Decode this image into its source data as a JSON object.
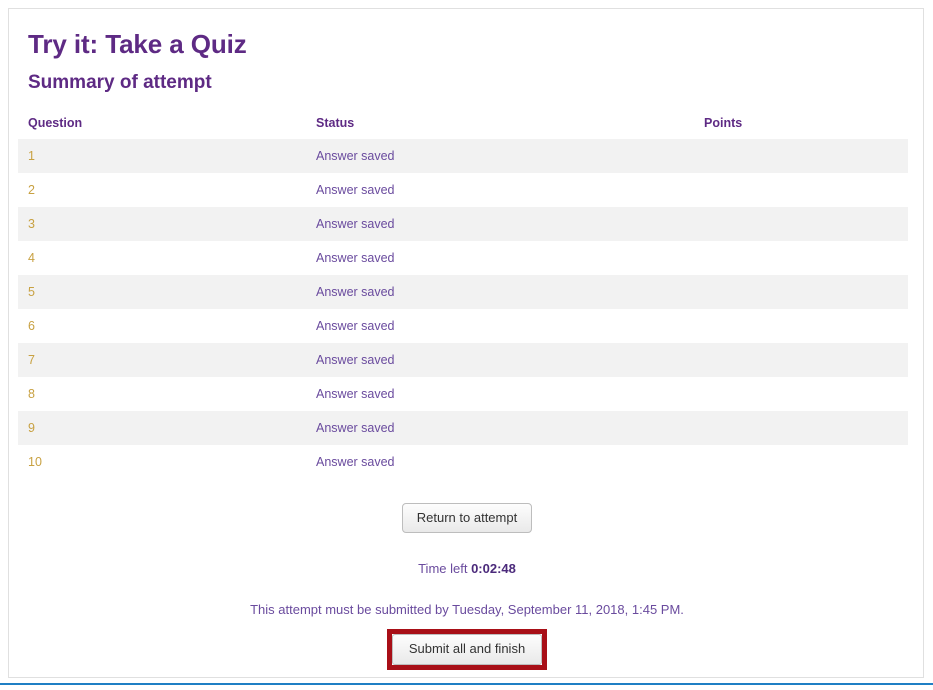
{
  "page": {
    "title": "Try it: Take a Quiz",
    "section_title": "Summary of attempt",
    "accent_heading_color": "#5e2a84",
    "link_color": "#c8a142",
    "text_color": "#6a4b9e",
    "highlight_box_color": "#a80f17",
    "row_stripe_color": "#f2f2f2",
    "bottom_rule_color": "#1f7fc4"
  },
  "table": {
    "headers": {
      "question": "Question",
      "status": "Status",
      "points": "Points"
    },
    "rows": [
      {
        "question": "1",
        "status": "Answer saved",
        "points": ""
      },
      {
        "question": "2",
        "status": "Answer saved",
        "points": ""
      },
      {
        "question": "3",
        "status": "Answer saved",
        "points": ""
      },
      {
        "question": "4",
        "status": "Answer saved",
        "points": ""
      },
      {
        "question": "5",
        "status": "Answer saved",
        "points": ""
      },
      {
        "question": "6",
        "status": "Answer saved",
        "points": ""
      },
      {
        "question": "7",
        "status": "Answer saved",
        "points": ""
      },
      {
        "question": "8",
        "status": "Answer saved",
        "points": ""
      },
      {
        "question": "9",
        "status": "Answer saved",
        "points": ""
      },
      {
        "question": "10",
        "status": "Answer saved",
        "points": ""
      }
    ]
  },
  "footer": {
    "return_button_label": "Return to attempt",
    "time_left_label": "Time left",
    "time_left_value": "0:02:48",
    "deadline_text": "This attempt must be submitted by Tuesday, September 11, 2018, 1:45 PM.",
    "submit_button_label": "Submit all and finish"
  }
}
